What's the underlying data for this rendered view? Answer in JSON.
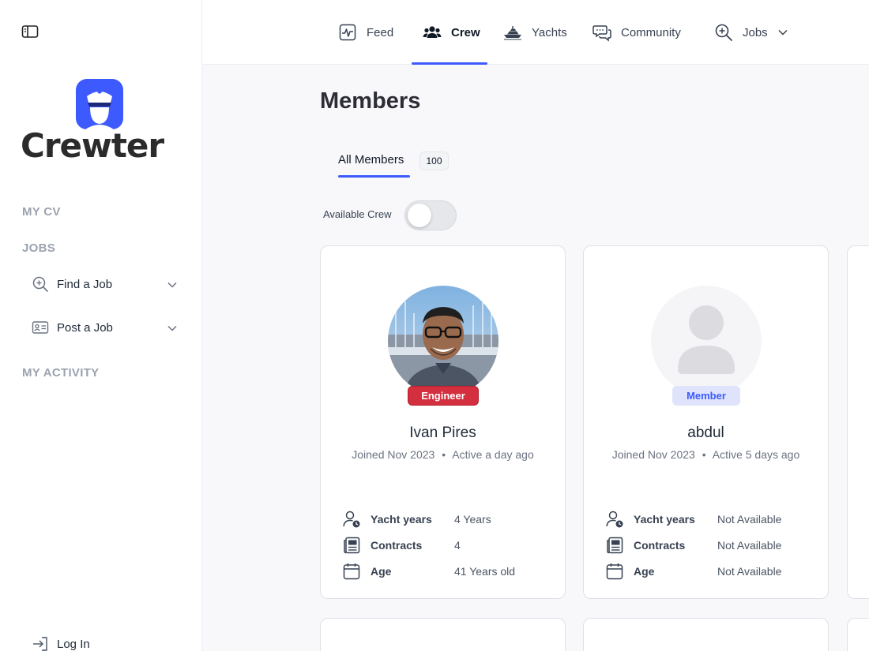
{
  "sidebar": {
    "brand": "Crewter",
    "sections": {
      "my_cv": "MY CV",
      "jobs": "JOBS",
      "my_activity": "MY ACTIVITY"
    },
    "job_items": [
      {
        "label": "Find a Job",
        "icon": "search-plus-icon"
      },
      {
        "label": "Post a Job",
        "icon": "id-card-icon"
      }
    ],
    "login": "Log In"
  },
  "topnav": {
    "items": [
      {
        "label": "Feed",
        "icon": "activity-icon"
      },
      {
        "label": "Crew",
        "icon": "users-icon",
        "active": true
      },
      {
        "label": "Yachts",
        "icon": "yacht-icon"
      },
      {
        "label": "Community",
        "icon": "chat-icon"
      },
      {
        "label": "Jobs",
        "icon": "search-plus-icon"
      }
    ]
  },
  "main": {
    "title": "Members",
    "tab": {
      "label": "All Members",
      "count": "100"
    },
    "filter": {
      "label": "Available Crew",
      "enabled": false
    }
  },
  "members": [
    {
      "name": "Ivan Pires",
      "role": "Engineer",
      "joined": "Joined Nov 2023",
      "active": "Active a day ago",
      "stats": {
        "yacht_years_label": "Yacht years",
        "yacht_years": "4 Years",
        "contracts_label": "Contracts",
        "contracts": "4",
        "age_label": "Age",
        "age": "41 Years old"
      }
    },
    {
      "name": "abdul",
      "role": "Member",
      "joined": "Joined Nov 2023",
      "active": "Active 5 days ago",
      "stats": {
        "yacht_years_label": "Yacht years",
        "yacht_years": "Not Available",
        "contracts_label": "Contracts",
        "contracts": "Not Available",
        "age_label": "Age",
        "age": "Not Available"
      }
    }
  ],
  "separator": "•",
  "colors": {
    "accent": "#3d5afe",
    "engineer_badge": "#d32f3f",
    "member_badge_bg": "#dfe4fc"
  }
}
